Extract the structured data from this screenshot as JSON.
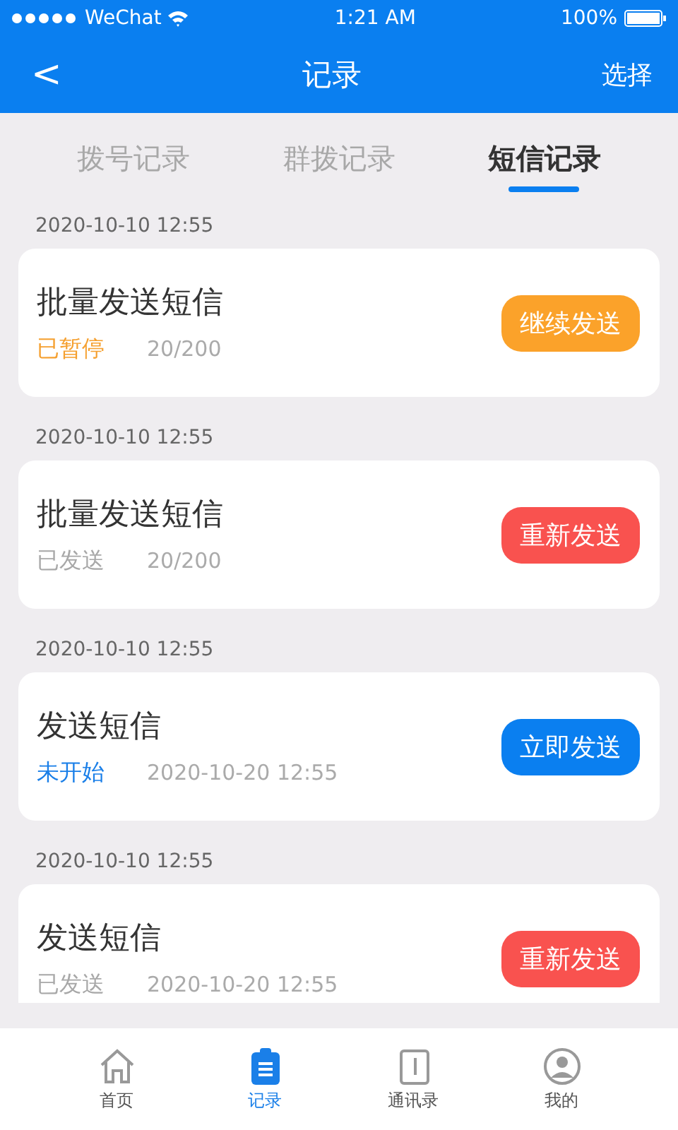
{
  "status_bar": {
    "carrier": "WeChat",
    "time": "1:21 AM",
    "battery": "100%"
  },
  "nav_bar": {
    "back": "<",
    "title": "记录",
    "action": "选择"
  },
  "tabs": [
    {
      "label": "拨号记录",
      "selected": false
    },
    {
      "label": "群拨记录",
      "selected": false
    },
    {
      "label": "短信记录",
      "selected": true
    }
  ],
  "records": [
    {
      "date": "2020-10-10 12:55",
      "title": "批量发送短信",
      "status": {
        "text": "已暂停",
        "color": "#f5a030"
      },
      "meta": "20/200",
      "button": {
        "label": "继续发送",
        "color": "#fba22a"
      }
    },
    {
      "date": "2020-10-10 12:55",
      "title": "批量发送短信",
      "status": {
        "text": "已发送",
        "color": "#a8a8a8"
      },
      "meta": "20/200",
      "button": {
        "label": "重新发送",
        "color": "#f9524f"
      }
    },
    {
      "date": "2020-10-10 12:55",
      "title": "发送短信",
      "status": {
        "text": "未开始",
        "color": "#1a7fe8"
      },
      "meta": "2020-10-20 12:55",
      "button": {
        "label": "立即发送",
        "color": "#0a7ff0"
      }
    },
    {
      "date": "2020-10-10 12:55",
      "title": "发送短信",
      "status": {
        "text": "已发送",
        "color": "#a8a8a8"
      },
      "meta": "2020-10-20 12:55",
      "button": {
        "label": "重新发送",
        "color": "#f9524f"
      }
    }
  ],
  "bottom_tabs": [
    {
      "label": "首页",
      "selected": false
    },
    {
      "label": "记录",
      "selected": true
    },
    {
      "label": "通讯录",
      "selected": false
    },
    {
      "label": "我的",
      "selected": false
    }
  ]
}
